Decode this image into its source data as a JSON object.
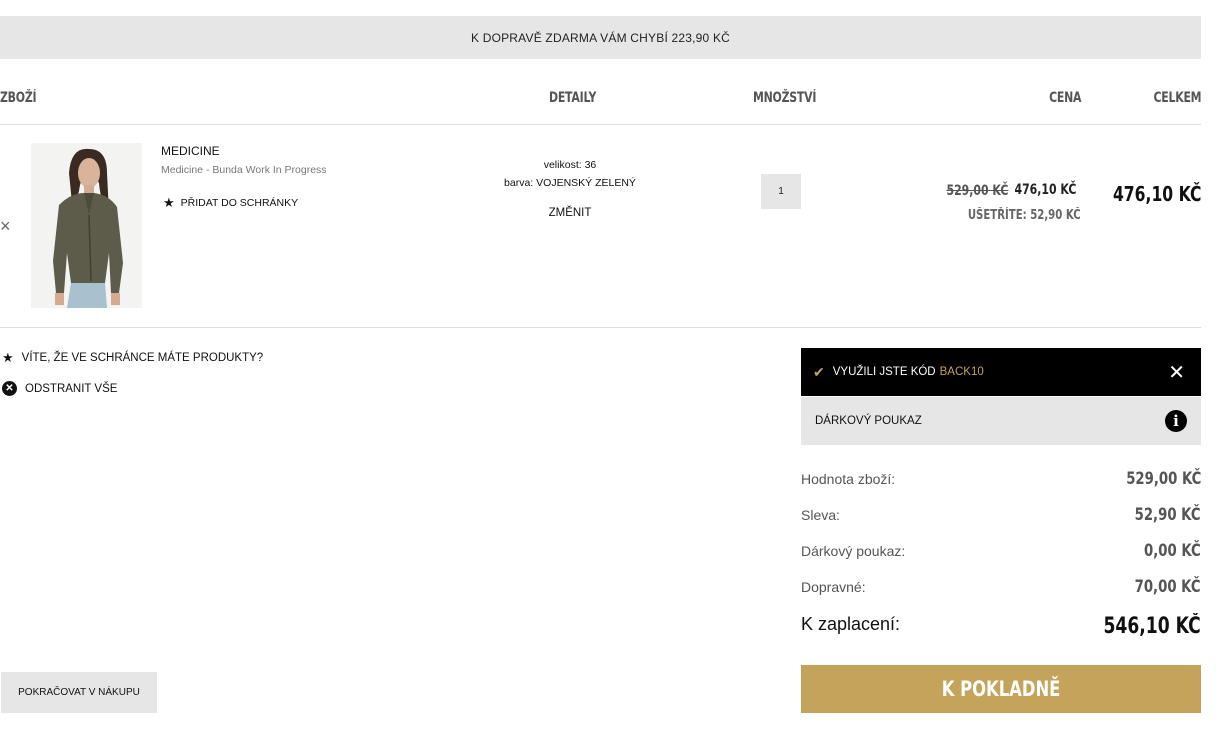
{
  "banner": {
    "text": "K DOPRAVĚ ZDARMA VÁM CHYBÍ 223,90 KČ"
  },
  "table_header": {
    "product": "ZBOŽÍ",
    "details": "DETAILY",
    "quantity": "MNOŽSTVÍ",
    "price": "CENA",
    "total": "CELKEM"
  },
  "item": {
    "remove": "×",
    "name": "MEDICINE",
    "description": "Medicine - Bunda Work In Progress",
    "wishlist_label": "PŘIDAT DO SCHRÁNKY",
    "size_label": "velikost:",
    "size": "36",
    "color_label": "barva:",
    "color": "VOJENSKÝ ZELENÝ",
    "change_label": "ZMĚNIT",
    "quantity": "1",
    "original_price": "529,00 KČ",
    "price": "476,10 KČ",
    "savings": "UŠETŘÍTE: 52,90 KČ",
    "total": "476,10 KČ"
  },
  "links": {
    "wishlist_notice": "VÍTE, ŽE VE SCHRÁNCE MÁTE PRODUKTY?",
    "remove_all": "ODSTRANIT VŠE"
  },
  "coupon": {
    "text": "VYUŽILI JSTE KÓD",
    "code": "BACK10"
  },
  "gift_voucher": {
    "label": "DÁRKOVÝ POUKAZ"
  },
  "summary": [
    {
      "label": "Hodnota zboží:",
      "value": "529,00 KČ"
    },
    {
      "label": "Sleva:",
      "value": "52,90 KČ"
    },
    {
      "label": "Dárkový poukaz:",
      "value": "0,00 KČ"
    },
    {
      "label": "Dopravné:",
      "value": "70,00 KČ"
    },
    {
      "label": "K zaplacení:",
      "value": "546,10 KČ"
    }
  ],
  "buttons": {
    "continue": "POKRAČOVAT V NÁKUPU",
    "checkout": "K POKLADNĚ"
  },
  "colors": {
    "accent": "#c4a35a",
    "panel_grey": "#e6e6e6",
    "dark": "#000000"
  }
}
